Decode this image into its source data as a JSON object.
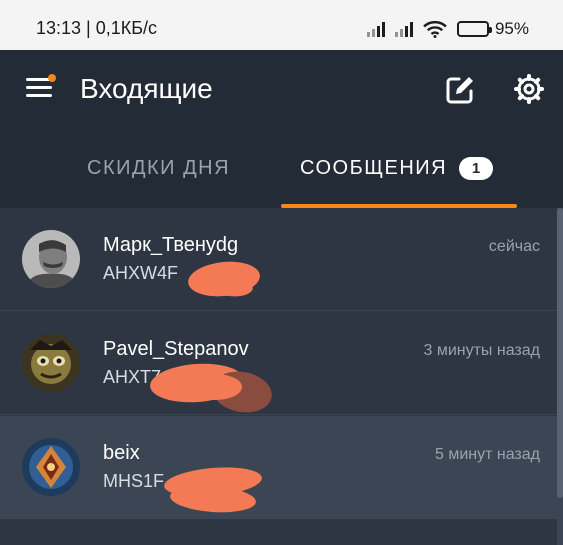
{
  "status_bar": {
    "time_speed": "13:13 | 0,1КБ/с",
    "battery_percent": "95%",
    "battery_level": 0.95
  },
  "app_bar": {
    "title": "Входящие",
    "icons": [
      "menu-icon",
      "compose-icon",
      "gear-icon"
    ],
    "has_notification_dot": true
  },
  "tabs": [
    {
      "label": "СКИДКИ ДНЯ",
      "active": false
    },
    {
      "label": "СООБЩЕНИЯ",
      "active": true,
      "badge": "1"
    }
  ],
  "messages": [
    {
      "name": "Марк_Твенуdg",
      "preview": "AHXW4F",
      "time": "сейчас",
      "selected": false,
      "preview_redacted": true
    },
    {
      "name": "Pavel_Stepanov",
      "preview": "AHXT7",
      "time": "3 минуты назад",
      "selected": false,
      "preview_redacted": true
    },
    {
      "name": "beix",
      "preview": "MHS1F",
      "time": "5 минут назад",
      "selected": true,
      "preview_redacted": true
    }
  ],
  "colors": {
    "accent": "#f28a1a",
    "background": "#232b36",
    "list_background": "#2d3642",
    "selected_row": "#3b4553",
    "redaction": "#f47a55"
  }
}
